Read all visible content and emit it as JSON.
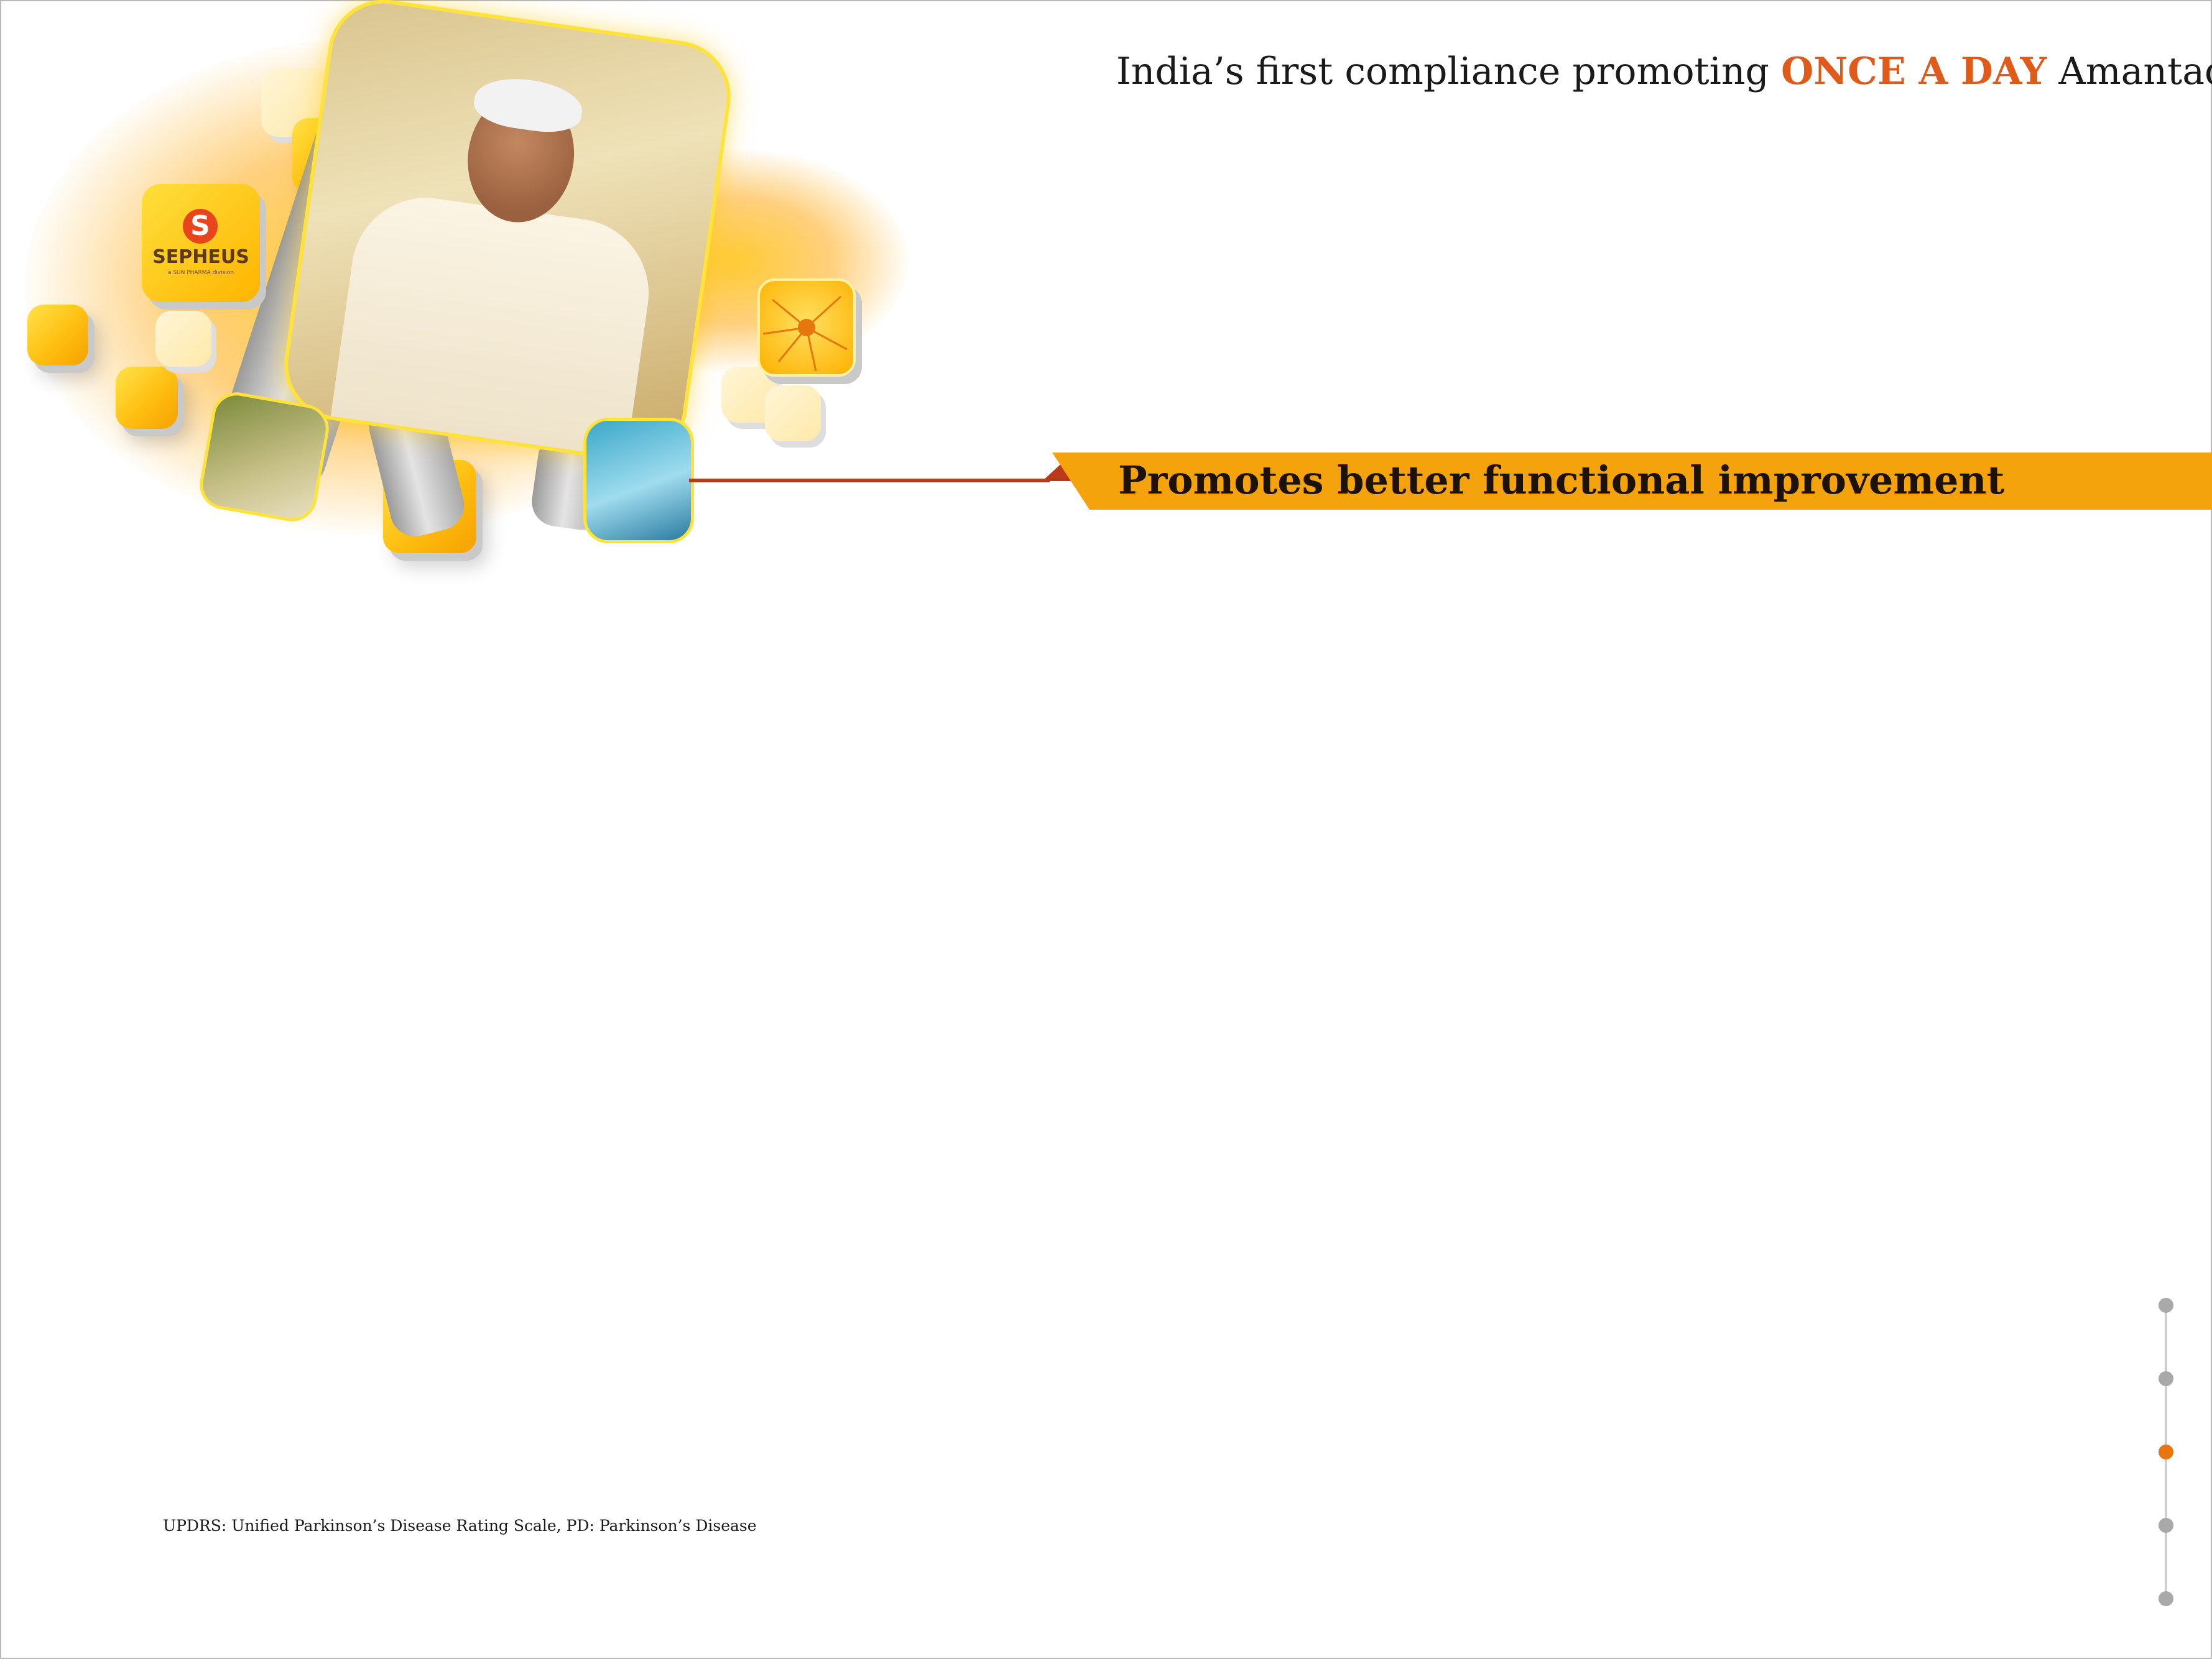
{
  "header": {
    "tagline_prefix": "India’s first compliance promoting",
    "tagline_highlight": "ONCE A DAY",
    "tagline_suffix": "Amantadine"
  },
  "brand": {
    "logo_letter": "S",
    "name": "SEPHEUS",
    "subtitle": "a SUN PHARMA division"
  },
  "banner": {
    "title": "Promotes better functional improvement"
  },
  "footnote": {
    "text": "UPDRS: Unified Parkinson’s Disease Rating Scale, PD: Parkinson’s Disease"
  },
  "pager": {
    "total_pages": 5,
    "active_page": 3
  },
  "colors": {
    "accent_orange": "#e05a1a",
    "banner_yellow": "#f5a30c",
    "connector_red": "#b83a1a",
    "pager_active": "#e8760e",
    "pager_inactive": "#a9a9a9"
  },
  "icons": {
    "brand_logo": "sepheus-logo-icon",
    "neuron_tile": "neuron-icon"
  }
}
